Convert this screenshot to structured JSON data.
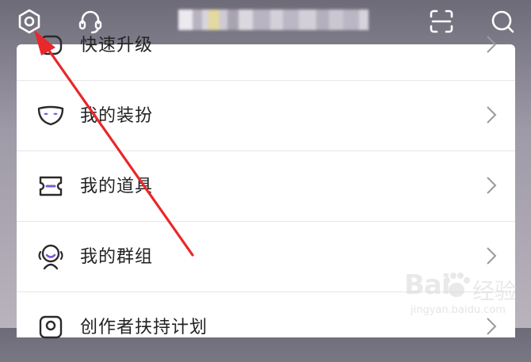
{
  "header": {
    "settings_icon": "settings-hexagon-icon",
    "support_icon": "headset-icon",
    "scan_icon": "scan-icon",
    "search_icon": "search-icon",
    "name_blurred": true
  },
  "menu": {
    "items": [
      {
        "label": "快速升级",
        "icon": "upgrade-icon"
      },
      {
        "label": "我的装扮",
        "icon": "mask-icon"
      },
      {
        "label": "我的道具",
        "icon": "ticket-icon"
      },
      {
        "label": "我的群组",
        "icon": "group-icon"
      },
      {
        "label": "创作者扶持计划",
        "icon": "creator-icon"
      }
    ]
  },
  "watermark": {
    "brand": "Bai",
    "brand_cn": "经验",
    "url": "jingyan.baidu.com"
  },
  "colors": {
    "background_top": "#6e6b79",
    "card": "#ffffff",
    "arrow": "#e8282a",
    "icon_purple": "#7a56d8"
  }
}
